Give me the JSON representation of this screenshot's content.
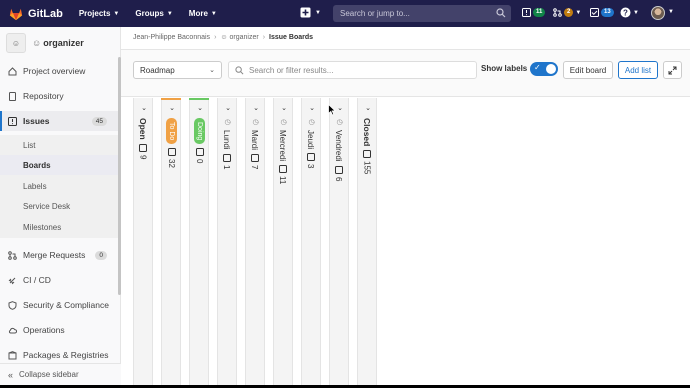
{
  "topbar": {
    "brand": "GitLab",
    "nav": [
      {
        "label": "Projects"
      },
      {
        "label": "Groups"
      },
      {
        "label": "More"
      }
    ],
    "search_placeholder": "Search or jump to...",
    "counters": {
      "issues": "11",
      "merge_requests": "2",
      "todos": "13"
    },
    "colors": {
      "bg": "#1f1e4b",
      "green": "#108548",
      "orange": "#c17d10",
      "blue": "#1f75cb"
    }
  },
  "sidebar": {
    "project_name": "organizer",
    "items": [
      {
        "label": "Project overview",
        "icon": "home-icon"
      },
      {
        "label": "Repository",
        "icon": "doc-icon"
      },
      {
        "label": "Issues",
        "icon": "issues-icon",
        "count": "45"
      },
      {
        "label": "Merge Requests",
        "icon": "merge-icon",
        "count": "0"
      },
      {
        "label": "CI / CD",
        "icon": "rocket-icon"
      },
      {
        "label": "Security & Compliance",
        "icon": "shield-icon"
      },
      {
        "label": "Operations",
        "icon": "cloud-icon"
      },
      {
        "label": "Packages & Registries",
        "icon": "package-icon"
      }
    ],
    "sub_items": [
      {
        "label": "List"
      },
      {
        "label": "Boards"
      },
      {
        "label": "Labels"
      },
      {
        "label": "Service Desk"
      },
      {
        "label": "Milestones"
      }
    ],
    "collapse_label": "Collapse sidebar"
  },
  "breadcrumb": {
    "owner": "Jean-Philippe Baconnais",
    "project": "organizer",
    "current": "Issue Boards"
  },
  "toolbar": {
    "board_select": "Roadmap",
    "filter_placeholder": "Search or filter results...",
    "show_labels": "Show labels",
    "show_labels_on": true,
    "edit_board": "Edit board",
    "add_list": "Add list"
  },
  "board": {
    "lists": [
      {
        "title": "Open",
        "count": "9",
        "kind": "plain"
      },
      {
        "title": "To Do",
        "count": "32",
        "kind": "label",
        "color": "#f0a145"
      },
      {
        "title": "Doing",
        "count": "0",
        "kind": "label",
        "color": "#69c963"
      },
      {
        "title": "Lundi",
        "count": "1",
        "kind": "milestone"
      },
      {
        "title": "Mardi",
        "count": "7",
        "kind": "milestone"
      },
      {
        "title": "Mercredi",
        "count": "11",
        "kind": "milestone"
      },
      {
        "title": "Jeudi",
        "count": "3",
        "kind": "milestone"
      },
      {
        "title": "Vendredi",
        "count": "6",
        "kind": "milestone"
      },
      {
        "title": "Closed",
        "count": "155",
        "kind": "plain"
      }
    ]
  }
}
